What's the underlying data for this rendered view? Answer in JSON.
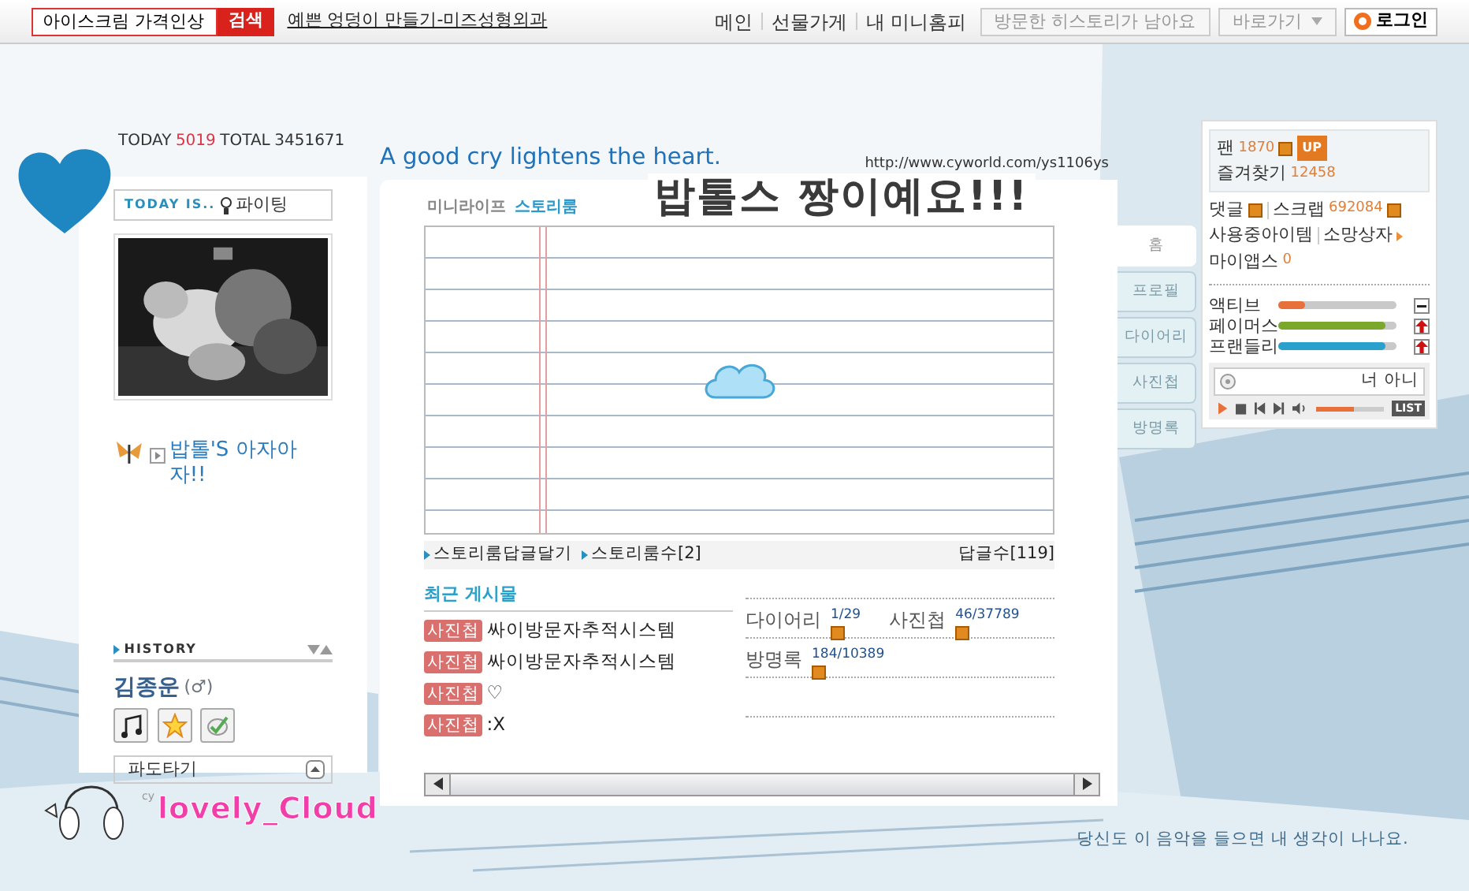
{
  "top_bar": {
    "search": {
      "value": "아이스크림 가격인상",
      "button": "검색"
    },
    "ad_link": "예쁜 엉덩이 만들기-미즈성형외과",
    "nav": [
      "메인",
      "선물가게",
      "내 미니홈피"
    ],
    "history_button": "방문한 히스토리가 남아요",
    "goto_select": "바로가기",
    "login_button": "로그인"
  },
  "counter": {
    "today_label": "TODAY",
    "today": "5019",
    "total_label": "TOTAL",
    "total": "3451671"
  },
  "profile": {
    "today_is_label": "TODAY IS..",
    "mood": "파이팅",
    "intro": "밥톨'S 아자아자!!",
    "history_label": "HISTORY",
    "name": "김종운",
    "gender": "(♂)",
    "wave_select": "파도타기"
  },
  "header": {
    "title": "A good cry lightens the heart.",
    "url": "http://www.cyworld.com/ys1106ys"
  },
  "room_tabs": [
    {
      "label": "미니라이프",
      "selected": false
    },
    {
      "label": "스토리룸",
      "selected": true
    }
  ],
  "banner_text": "밥톨스 짱이예요!!!",
  "story_footer": {
    "links": [
      "스토리룸답글달기",
      "스토리룸수[2]"
    ],
    "reply_count": "답글수[119]"
  },
  "recent": {
    "title": "최근 게시물",
    "posts": [
      {
        "tag": "사진첩",
        "title": "싸이방문자추적시스템"
      },
      {
        "tag": "사진첩",
        "title": "싸이방문자추적시스템"
      },
      {
        "tag": "사진첩",
        "title": "♡"
      },
      {
        "tag": "사진첩",
        "title": ":X"
      }
    ]
  },
  "stats": [
    [
      {
        "label": "다이어리",
        "count": "1/29",
        "new": true
      },
      {
        "label": "사진첩",
        "count": "46/37789",
        "new": true
      }
    ],
    [
      {
        "label": "방명록",
        "count": "184/10389",
        "new": true
      }
    ]
  ],
  "side_tabs": [
    {
      "label": "홈",
      "selected": true
    },
    {
      "label": "프로필",
      "selected": false
    },
    {
      "label": "다이어리",
      "selected": false
    },
    {
      "label": "사진첩",
      "selected": false
    },
    {
      "label": "방명록",
      "selected": false
    }
  ],
  "right_panel": {
    "fan_label": "팬",
    "fan": "1870",
    "fan_new": true,
    "up_badge": "UP",
    "bookmark_label": "즐겨찾기",
    "bookmark": "12458",
    "links": [
      {
        "label": "댓글",
        "new": true
      },
      {
        "label": "스크랩",
        "count": "692084",
        "new": true
      }
    ],
    "links2": [
      "사용중아이템",
      "소망상자"
    ],
    "apps_label": "마이앱스",
    "apps": "0",
    "meters": [
      {
        "name": "액티브",
        "level": 0.22,
        "color": "#e8703a",
        "kind": "steady"
      },
      {
        "name": "페이머스",
        "level": 0.9,
        "color": "#7aa82a",
        "kind": "rising"
      },
      {
        "name": "프랜들리",
        "level": 0.9,
        "color": "#2aa0cc",
        "kind": "rising"
      }
    ],
    "player": {
      "song": "너 아니",
      "volume": {
        "level": 0.55
      },
      "list_button": "LIST"
    }
  },
  "footer": {
    "logo": "lovely_Cloud",
    "logo_small": "cy",
    "caption": "당신도 이 음악을 들으면 내 생각이 나나요."
  }
}
